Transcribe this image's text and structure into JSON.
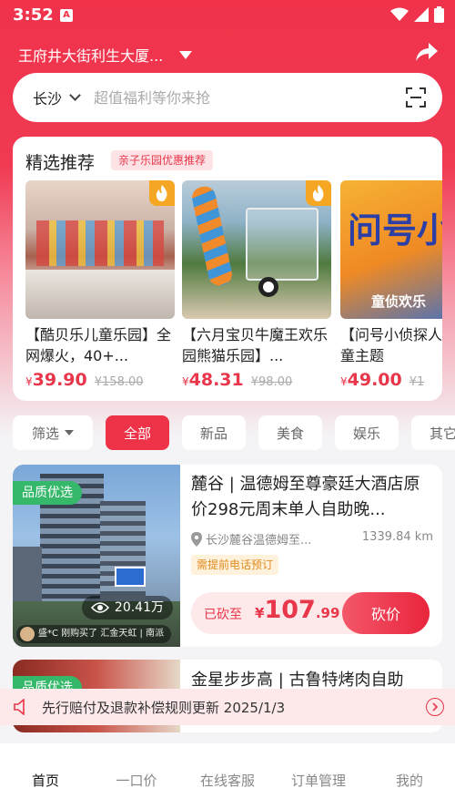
{
  "status": {
    "time": "3:52",
    "app_icon": "A"
  },
  "header": {
    "location": "王府井大街利生大厦..."
  },
  "search": {
    "city": "长沙",
    "placeholder": "超值福利等你来抢"
  },
  "recommend": {
    "title": "精选推荐",
    "tag": "亲子乐园优惠推荐",
    "cards": [
      {
        "title": "【酷贝乐儿童乐园】全网爆火，40+...",
        "currency": "¥",
        "price": "39.90",
        "original": "¥158.00"
      },
      {
        "title": "【六月宝贝牛魔王欢乐园熊猫乐园】...",
        "currency": "¥",
        "price": "48.31",
        "original": "¥98.00"
      },
      {
        "title": "【问号小侦探人票 儿童主题",
        "currency": "¥",
        "price": "49.00",
        "original": "¥1"
      }
    ],
    "card3_banner": "问号小侦",
    "card3_sub": "童侦欢乐"
  },
  "filters": {
    "screen": "筛选",
    "items": [
      "全部",
      "新品",
      "美食",
      "娱乐",
      "其它"
    ]
  },
  "deals": [
    {
      "badge": "品质优选",
      "title": "麓谷 | 温德姆至尊豪廷大酒店原价298元周末单人自助晚...",
      "address": "长沙麓谷温德姆至...",
      "distance": "1339.84 km",
      "note": "需提前电话预订",
      "views": "20.41万",
      "notice": "盛*C 刚购买了 汇金天虹 | 南派",
      "cut_label": "已砍至",
      "cut_currency": "¥",
      "cut_int": "107",
      "cut_dec": ".99",
      "cut_button": "砍价"
    },
    {
      "badge": "品质优选",
      "title": "金星步步高 | 古鲁特烤肉自助"
    }
  ],
  "notice": {
    "text": "先行赔付及退款补偿规则更新 2025/1/3"
  },
  "tabbar": {
    "items": [
      "首页",
      "一口价",
      "在线客服",
      "订单管理",
      "我的"
    ]
  },
  "colors": {
    "accent": "#ee3348",
    "badge_green": "#35b86a",
    "note_orange": "#e08a1c"
  }
}
